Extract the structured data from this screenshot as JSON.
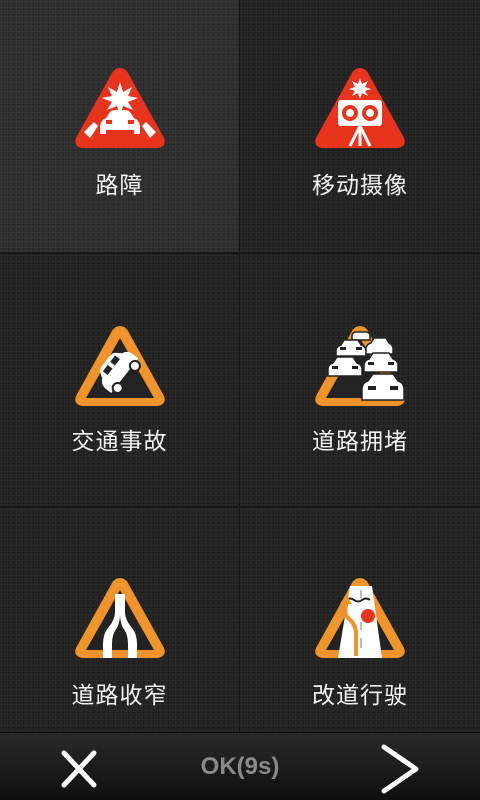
{
  "tiles": [
    {
      "label": "路障",
      "icon": "roadblock-icon"
    },
    {
      "label": "移动摄像",
      "icon": "mobile-camera-icon"
    },
    {
      "label": "交通事故",
      "icon": "traffic-accident-icon"
    },
    {
      "label": "道路拥堵",
      "icon": "traffic-jam-icon"
    },
    {
      "label": "道路收窄",
      "icon": "road-narrows-icon"
    },
    {
      "label": "改道行驶",
      "icon": "detour-icon"
    }
  ],
  "bottom_bar": {
    "ok_label": "OK(9s)",
    "close_icon": "close-icon",
    "next_icon": "chevron-right-icon"
  },
  "colors": {
    "alert_red": "#e8341c",
    "warning_orange": "#f0932b",
    "background": "#232323",
    "selected_background": "#2e2e2e"
  }
}
